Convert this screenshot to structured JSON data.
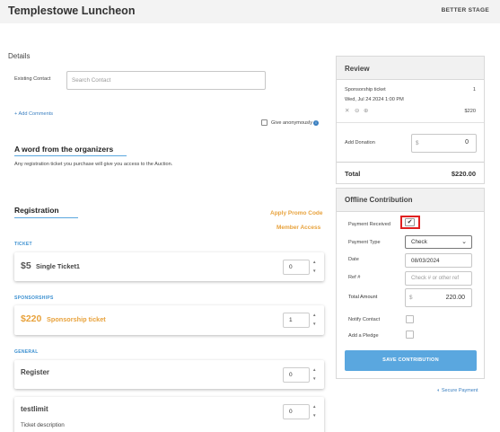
{
  "header": {
    "title": "Templestowe Luncheon",
    "brand": "BETTER STAGE"
  },
  "details": {
    "heading": "Details",
    "existing_contact_label": "Existing Contact",
    "search_placeholder": "Search Contact",
    "add_comments": "+ Add Comments",
    "give_anonymously": "Give anonymously",
    "give_anonymously_checked": false
  },
  "organizers": {
    "heading": "A word from the organizers",
    "text": "Any registration ticket you purchase will give you access to the Auction."
  },
  "registration": {
    "heading": "Registration",
    "promo_link": "Apply Promo Code",
    "member_link": "Member Access"
  },
  "tickets": {
    "ticket_category": "TICKET",
    "ticket1": {
      "price": "$5",
      "name": "Single Ticket1",
      "qty": "0"
    },
    "sponsorships_category": "SPONSORSHIPS",
    "sponsor": {
      "price": "$220",
      "name": "Sponsorship ticket",
      "qty": "1"
    },
    "general_category": "GENERAL",
    "register": {
      "name": "Register",
      "qty": "0"
    },
    "testlimit": {
      "name": "testlimit",
      "qty": "0",
      "description": "Ticket description"
    }
  },
  "review": {
    "heading": "Review",
    "item_name": "Sponsorship ticket",
    "item_date": "Wed, Jul 24 2024 1:00 PM",
    "item_qty": "1",
    "item_price": "$220",
    "add_donation_label": "Add Donation",
    "donation_currency": "$",
    "donation_value": "0",
    "total_label": "Total",
    "total_value": "$220.00"
  },
  "offline": {
    "heading": "Offline Contribution",
    "payment_received_label": "Payment Received",
    "payment_received_checked": true,
    "payment_type_label": "Payment Type",
    "payment_type_value": "Check",
    "date_label": "Date",
    "date_value": "08/03/2024",
    "ref_label": "Ref #",
    "ref_placeholder": "Check # or other ref",
    "total_amount_label": "Total Amount",
    "total_currency": "$",
    "total_amount_value": "220.00",
    "notify_label": "Notify Contact",
    "pledge_label": "Add a Pledge",
    "save_button": "SAVE CONTRIBUTION",
    "secure_payment": "Secure Payment"
  },
  "colors": {
    "accent": "#5aa7df",
    "orange": "#e8a23c",
    "highlight": "#e02020"
  }
}
